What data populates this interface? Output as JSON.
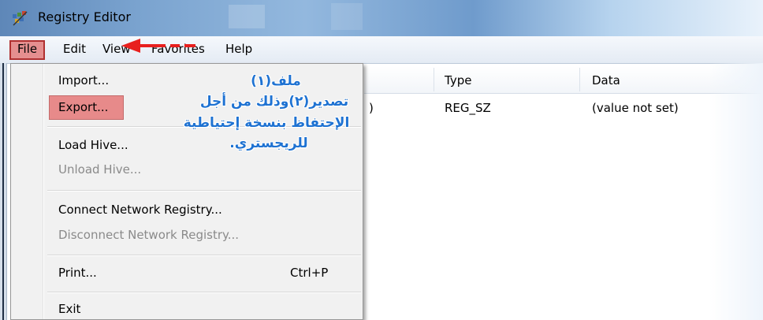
{
  "window": {
    "title": "Registry Editor"
  },
  "menubar": [
    "File",
    "Edit",
    "View",
    "Favorites",
    "Help"
  ],
  "list": {
    "columns": [
      "Type",
      "Data"
    ],
    "row": {
      "name_fragment": ")",
      "type": "REG_SZ",
      "data": "(value not set)"
    }
  },
  "file_menu": {
    "import": "Import...",
    "export": "Export...",
    "load_hive": "Load Hive...",
    "unload_hive": "Unload Hive...",
    "connect": "Connect Network Registry...",
    "disconnect": "Disconnect Network Registry...",
    "print": "Print...",
    "print_shortcut": "Ctrl+P",
    "exit": "Exit"
  },
  "annotation": {
    "line1": "ملف(١)",
    "line2": "تصدير(٢)وذلك من أجل",
    "line3": "الإحتفاظ بنسخة إحتياطية",
    "line4": "للريجستري."
  },
  "colors": {
    "highlight": "#e78a8a",
    "annotation": "#1e72d2",
    "arrow": "#e8201e"
  }
}
